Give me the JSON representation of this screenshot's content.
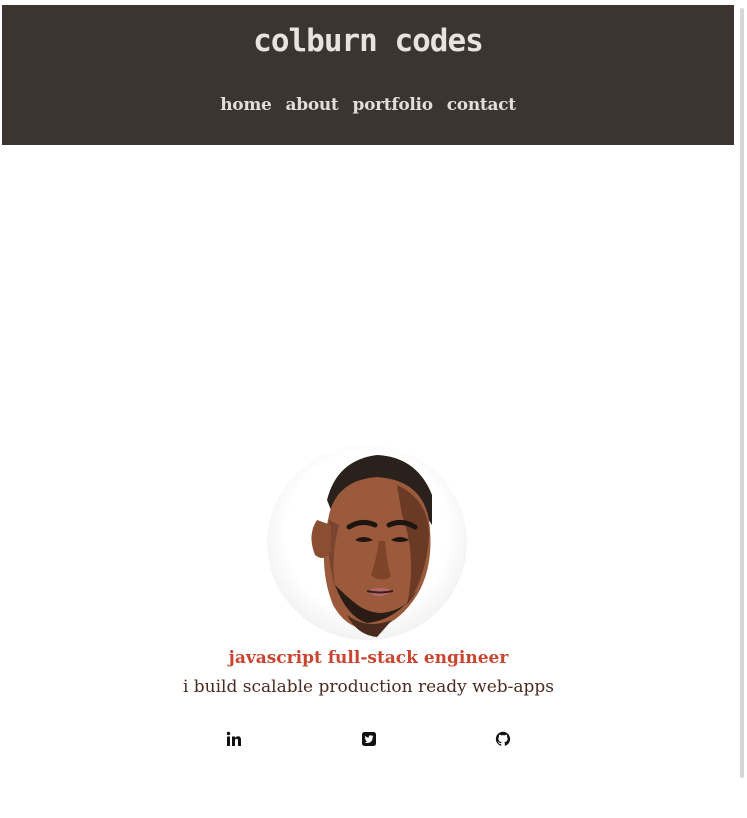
{
  "header": {
    "title": "colburn codes",
    "nav": [
      {
        "label": "home"
      },
      {
        "label": "about"
      },
      {
        "label": "portfolio"
      },
      {
        "label": "contact"
      }
    ]
  },
  "hero": {
    "avatar_icon": "illustrated-portrait",
    "headline": "javascript full-stack engineer",
    "tagline": "i build scalable production ready web-apps"
  },
  "social": [
    {
      "icon": "linkedin-icon"
    },
    {
      "icon": "twitter-icon"
    },
    {
      "icon": "github-icon"
    }
  ],
  "colors": {
    "header_bg": "#3b3430",
    "header_text": "#e8e3dc",
    "accent": "#c8452f",
    "tagline": "#4a2b22"
  }
}
